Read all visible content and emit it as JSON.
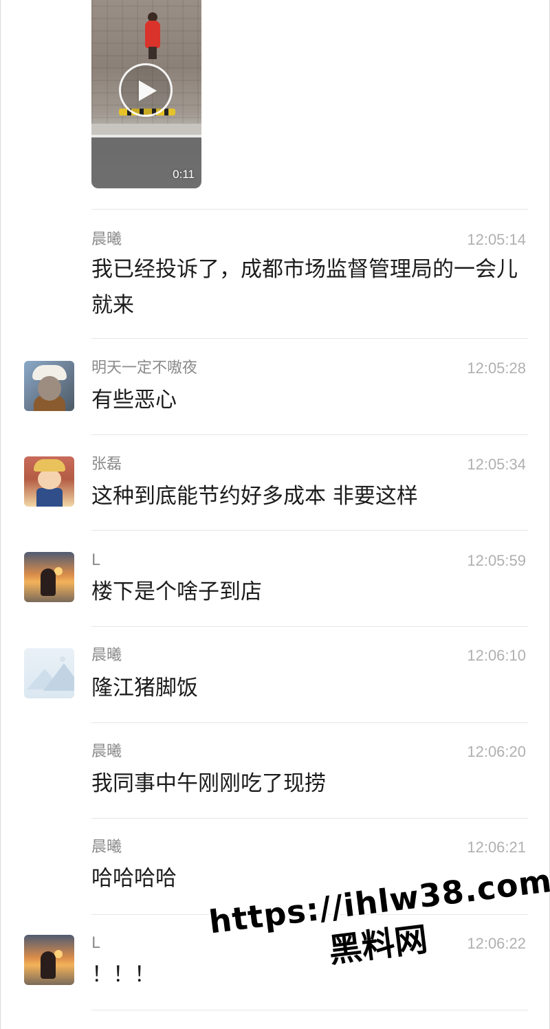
{
  "video": {
    "duration": "0:11",
    "play_icon": "play-icon"
  },
  "messages": [
    {
      "sender": "晨曦",
      "time": "12:05:14",
      "text": "我已经投诉了，成都市场监督管理局的一会儿就来",
      "avatar": "none"
    },
    {
      "sender": "明天一定不嗷夜",
      "time": "12:05:28",
      "text": "有些恶心",
      "avatar": "monkey-avatar"
    },
    {
      "sender": "张磊",
      "time": "12:05:34",
      "text": "这种到底能节约好多成本 非要这样",
      "avatar": "anime-boy-avatar"
    },
    {
      "sender": "L",
      "time": "12:05:59",
      "text": "楼下是个啥子到店",
      "avatar": "sunset-avatar"
    },
    {
      "sender": "晨曦",
      "time": "12:06:10",
      "text": "隆江猪脚饭",
      "avatar": "placeholder-image-avatar"
    },
    {
      "sender": "晨曦",
      "time": "12:06:20",
      "text": "我同事中午刚刚吃了现捞",
      "avatar": "none"
    },
    {
      "sender": "晨曦",
      "time": "12:06:21",
      "text": "哈哈哈哈",
      "avatar": "none"
    },
    {
      "sender": "L",
      "time": "12:06:22",
      "text": "！！！",
      "avatar": "sunset-avatar"
    }
  ],
  "watermark": {
    "url": "https://ihlw38.com",
    "name": "黑料网"
  }
}
